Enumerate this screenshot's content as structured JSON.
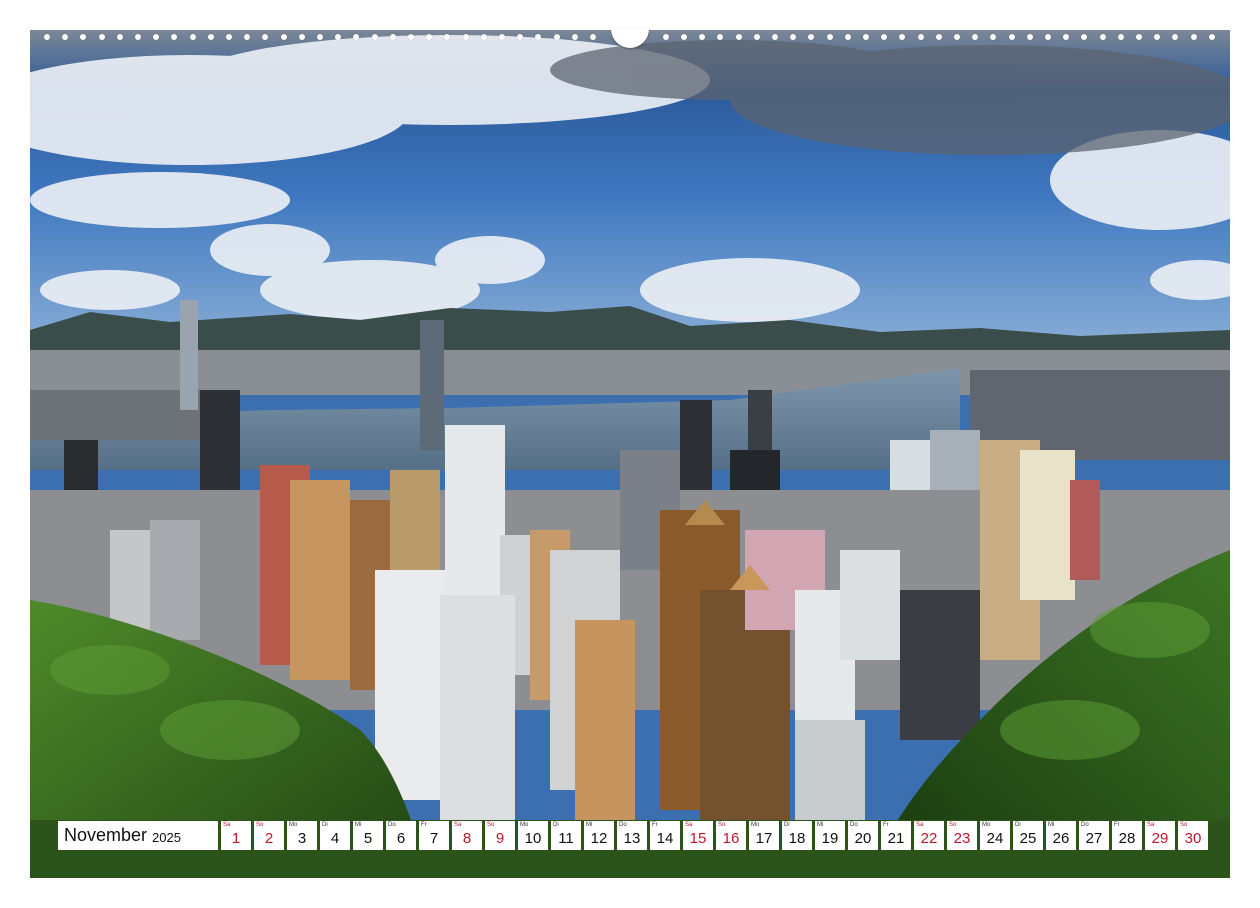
{
  "calendar": {
    "month": "November",
    "year": "2025",
    "days": [
      {
        "wd": "Sa",
        "n": "1",
        "we": true
      },
      {
        "wd": "So",
        "n": "2",
        "we": true
      },
      {
        "wd": "Mo",
        "n": "3",
        "we": false
      },
      {
        "wd": "Di",
        "n": "4",
        "we": false
      },
      {
        "wd": "Mi",
        "n": "5",
        "we": false
      },
      {
        "wd": "Do",
        "n": "6",
        "we": false
      },
      {
        "wd": "Fr",
        "n": "7",
        "we": false
      },
      {
        "wd": "Sa",
        "n": "8",
        "we": true
      },
      {
        "wd": "So",
        "n": "9",
        "we": true
      },
      {
        "wd": "Mo",
        "n": "10",
        "we": false
      },
      {
        "wd": "Di",
        "n": "11",
        "we": false
      },
      {
        "wd": "Mi",
        "n": "12",
        "we": false
      },
      {
        "wd": "Do",
        "n": "13",
        "we": false
      },
      {
        "wd": "Fr",
        "n": "14",
        "we": false
      },
      {
        "wd": "Sa",
        "n": "15",
        "we": true
      },
      {
        "wd": "So",
        "n": "16",
        "we": true
      },
      {
        "wd": "Mo",
        "n": "17",
        "we": false
      },
      {
        "wd": "Di",
        "n": "18",
        "we": false
      },
      {
        "wd": "Mi",
        "n": "19",
        "we": false
      },
      {
        "wd": "Do",
        "n": "20",
        "we": false
      },
      {
        "wd": "Fr",
        "n": "21",
        "we": false
      },
      {
        "wd": "Sa",
        "n": "22",
        "we": true
      },
      {
        "wd": "So",
        "n": "23",
        "we": true
      },
      {
        "wd": "Mo",
        "n": "24",
        "we": false
      },
      {
        "wd": "Di",
        "n": "25",
        "we": false
      },
      {
        "wd": "Mi",
        "n": "26",
        "we": false
      },
      {
        "wd": "Do",
        "n": "27",
        "we": false
      },
      {
        "wd": "Fr",
        "n": "28",
        "we": false
      },
      {
        "wd": "Sa",
        "n": "29",
        "we": true
      },
      {
        "wd": "So",
        "n": "30",
        "we": true
      }
    ]
  },
  "colors": {
    "weekend": "#c0152b",
    "sky": "#2f5f9e",
    "harbor": "#6f8aa3",
    "hills": "#2f5a1f"
  }
}
